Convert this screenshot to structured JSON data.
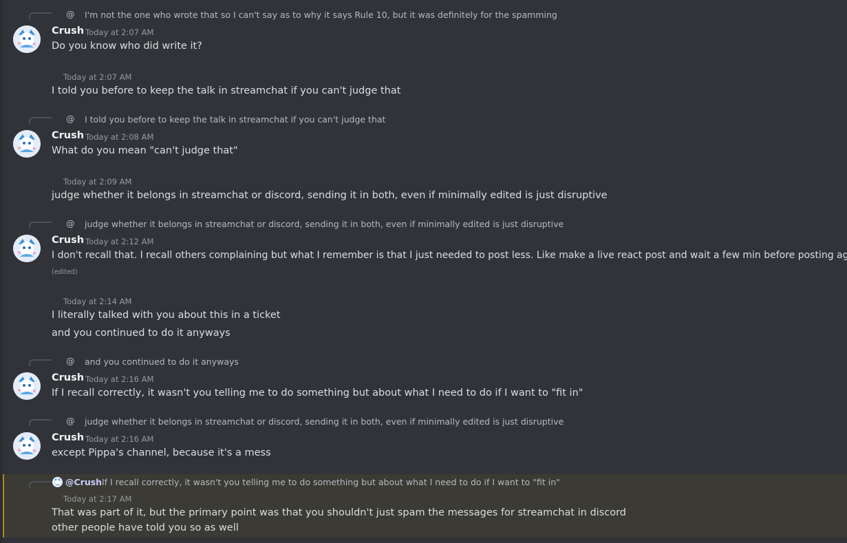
{
  "messages": [
    {
      "reply_at": "@",
      "reply_text": "I'm not the one who wrote that so I can't say as to why it says Rule 10, but it was definitely for the spamming",
      "author": "Crush",
      "timestamp": "Today at 2:07 AM",
      "lines": [
        "Do you know who did write it?"
      ]
    },
    {
      "timestamp": "Today at 2:07 AM",
      "lines": [
        "I told you before to keep the talk in streamchat if you can't judge that"
      ]
    },
    {
      "reply_at": "@",
      "reply_text": "I told you before to keep the talk in streamchat if you can't judge that",
      "author": "Crush",
      "timestamp": "Today at 2:08 AM",
      "lines": [
        "What do you mean \"can't judge that\""
      ]
    },
    {
      "timestamp": "Today at 2:09 AM",
      "lines": [
        "judge whether it belongs in streamchat or discord, sending it in both, even if minimally edited is just disruptive"
      ]
    },
    {
      "reply_at": "@",
      "reply_text": "judge whether it belongs in streamchat or discord, sending it in both, even if minimally edited is just disruptive",
      "author": "Crush",
      "timestamp": "Today at 2:12 AM",
      "lines": [
        "I don't recall that. I recall others complaining but what I remember is that I just needed to post less. Like make a live react post and wait a few min before posting again"
      ],
      "edited": "(edited)"
    },
    {
      "timestamp": "Today at 2:14 AM",
      "lines": [
        "I literally talked with you about this in a ticket",
        "and you continued to do it anyways"
      ]
    },
    {
      "reply_at": "@",
      "reply_text": "and you continued to do it anyways",
      "author": "Crush",
      "timestamp": "Today at 2:16 AM",
      "lines": [
        "If I recall correctly, it wasn't you telling me to do something but about what I need to do if I want to \"fit in\""
      ]
    },
    {
      "reply_at": "@",
      "reply_text": "judge whether it belongs in streamchat or discord, sending it in both, even if minimally edited is just disruptive",
      "author": "Crush",
      "timestamp": "Today at 2:16 AM",
      "lines": [
        "except Pippa's channel, because it's a mess"
      ]
    },
    {
      "mention_name": "@Crush",
      "mention_text": "If I recall correctly, it wasn't you telling me to do something but about what I need to do if I want to \"fit in\"",
      "timestamp": "Today at 2:17 AM",
      "lines": [
        "That was part of it, but the primary point was that you shouldn't just spam the messages for streamchat in discord",
        "other people have told you so as well"
      ]
    }
  ],
  "colors": {
    "background": "#313338",
    "highlight_background": "#3b3a34",
    "highlight_border": "#b08a1e",
    "text": "#dbdee1",
    "muted": "#949ba4",
    "mention": "#c9cdfb"
  },
  "icons": {
    "avatar": "blue-white-character-avatar-icon",
    "reply": "reply-connector-line"
  }
}
